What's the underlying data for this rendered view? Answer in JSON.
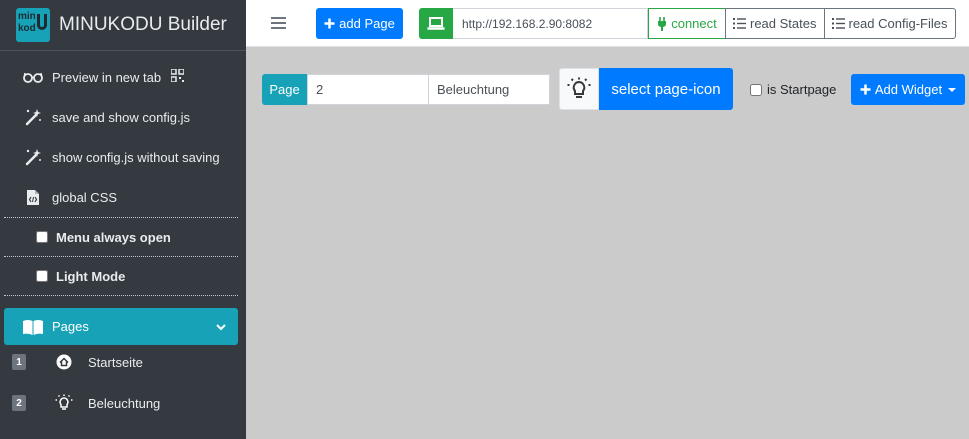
{
  "app": {
    "title": "MINUKODU Builder",
    "logo_line1": "min",
    "logo_line2": "kod"
  },
  "sidebar": {
    "items": [
      {
        "label": "Preview in new tab",
        "icon": "glasses-icon"
      },
      {
        "label": "save and show config.js",
        "icon": "magic-wand-icon"
      },
      {
        "label": "show config.js without saving",
        "icon": "magic-wand-icon"
      },
      {
        "label": "global CSS",
        "icon": "code-file-icon"
      }
    ],
    "menu_always_open": {
      "label": "Menu always open",
      "checked": false
    },
    "light_mode": {
      "label": "Light Mode",
      "checked": false
    },
    "pages_section": {
      "label": "Pages",
      "icon": "open-book-icon"
    },
    "pages": [
      {
        "number": "1",
        "label": "Startseite",
        "icon": "home-icon"
      },
      {
        "number": "2",
        "label": "Beleuchtung",
        "icon": "lightbulb-icon"
      }
    ]
  },
  "toolbar": {
    "add_page_label": "add Page",
    "url_value": "http://192.168.2.90:8082",
    "connect_label": "connect",
    "read_states_label": "read States",
    "read_config_label": "read Config-Files"
  },
  "page_editor": {
    "page_label": "Page",
    "page_number_value": "2",
    "page_name_value": "Beleuchtung",
    "select_icon_label": "select page-icon",
    "is_startpage_label": "is Startpage",
    "is_startpage_checked": false,
    "add_widget_label": "Add Widget"
  },
  "colors": {
    "sidebar_bg": "#343a40",
    "accent_teal": "#17a2b8",
    "primary_blue": "#007bff",
    "success_green": "#28a745",
    "content_bg": "#cbcbcb"
  }
}
